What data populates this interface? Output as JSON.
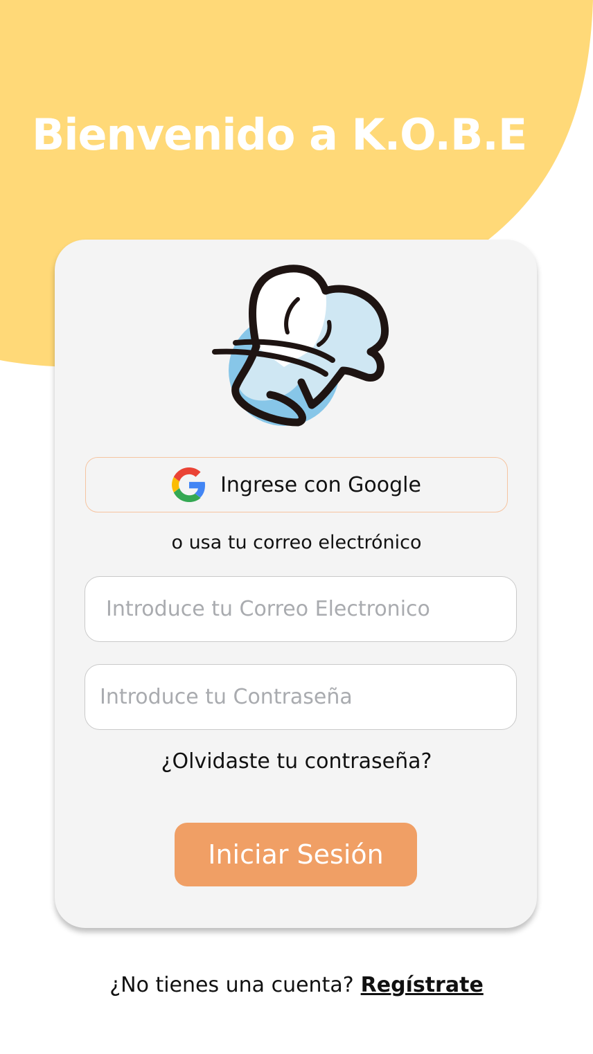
{
  "colors": {
    "background_blob": "#ffd978",
    "card": "#f4f4f4",
    "primary_button": "#f09f65",
    "google_border": "#f6c4a0"
  },
  "header": {
    "title": "Bienvenido a K.O.B.E"
  },
  "logo": {
    "icon": "chef-hat-icon"
  },
  "google_button": {
    "label": "Ingrese con Google",
    "icon": "google-icon"
  },
  "divider_text": "o usa tu correo electrónico",
  "email": {
    "value": "",
    "placeholder": "Introduce tu Correo Electronico"
  },
  "password": {
    "value": "",
    "placeholder": "Introduce tu Contraseña"
  },
  "forgot_password": "¿Olvidaste tu contraseña?",
  "login_button": "Iniciar Sesión",
  "footer": {
    "prompt": "¿No tienes una cuenta?",
    "register_link": "Regístrate"
  }
}
